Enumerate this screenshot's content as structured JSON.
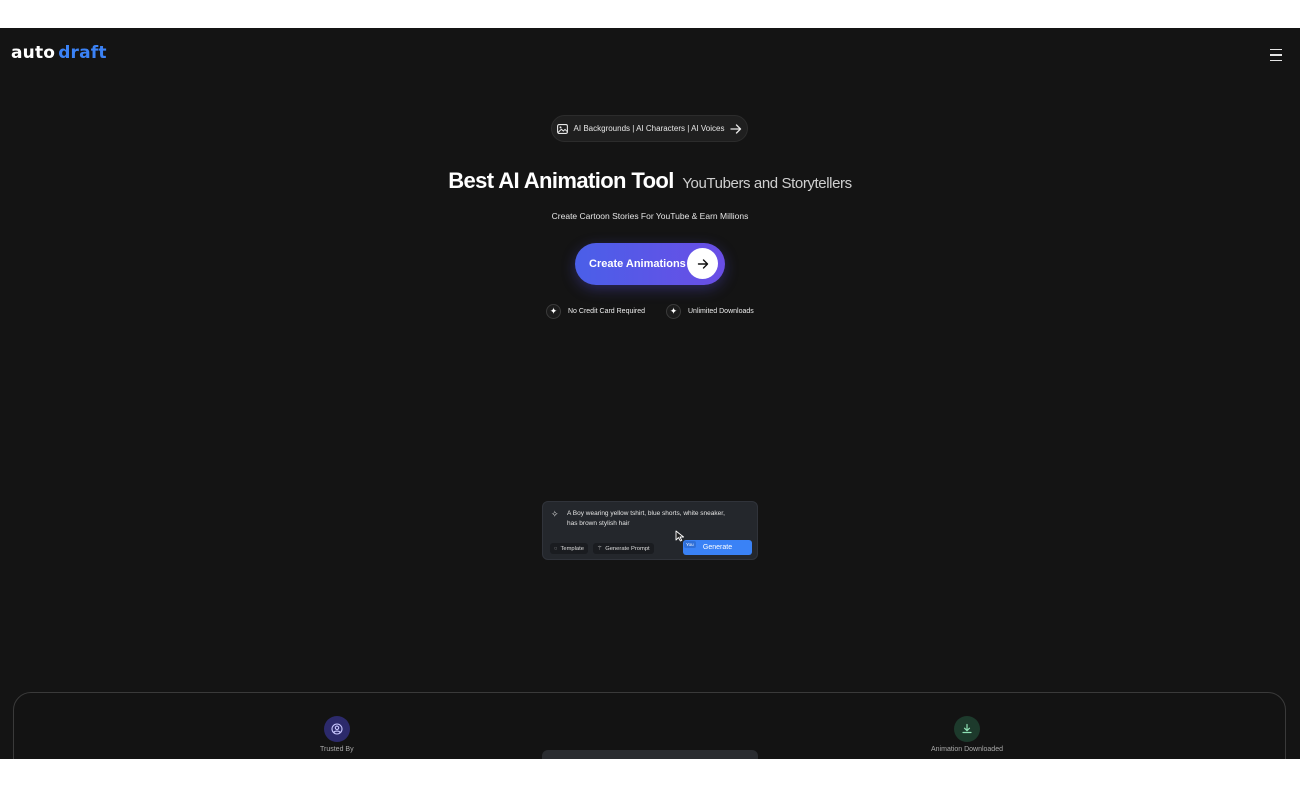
{
  "nav": {
    "logo_part1": "auto",
    "logo_part2": "draft",
    "menu_icon": "hamburger-menu-icon"
  },
  "hero": {
    "pill_label": "AI Backgrounds | AI Characters | AI Voices",
    "title": "Best AI Animation Tool",
    "title_suffix": "YouTubers and Storytellers",
    "tagline": "Create Cartoon Stories For YouTube & Earn Millions",
    "cta_label": "Create Animations"
  },
  "features": [
    {
      "label": "No Credit Card Required"
    },
    {
      "label": "Unlimited Downloads"
    }
  ],
  "prompt_card": {
    "text": "A Boy wearing yellow tshirt, blue shorts, white sneaker, has brown stylish hair",
    "template_label": "Template",
    "generate_prompt_label": "Generate Prompt",
    "you_tag": "You",
    "generate_label": "Generate"
  },
  "stats": {
    "trusted_by_label": "Trusted By",
    "downloaded_label": "Animation Downloaded"
  },
  "colors": {
    "background": "#141414",
    "brand_blue": "#3b82f6",
    "cta_gradient_start": "#4a5fe8",
    "cta_gradient_end": "#6a4ee6"
  }
}
